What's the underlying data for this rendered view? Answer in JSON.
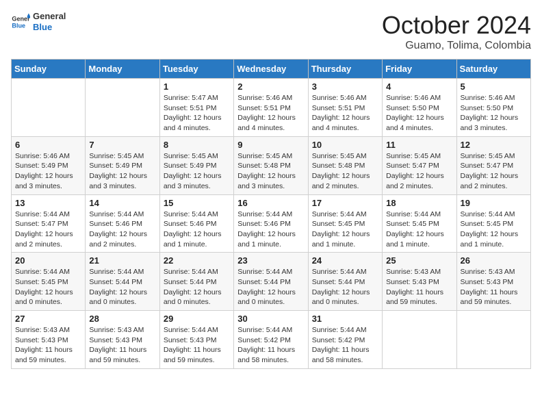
{
  "header": {
    "logo_line1": "General",
    "logo_line2": "Blue",
    "month": "October 2024",
    "location": "Guamo, Tolima, Colombia"
  },
  "weekdays": [
    "Sunday",
    "Monday",
    "Tuesday",
    "Wednesday",
    "Thursday",
    "Friday",
    "Saturday"
  ],
  "weeks": [
    [
      {
        "day": "",
        "sunrise": "",
        "sunset": "",
        "daylight": ""
      },
      {
        "day": "",
        "sunrise": "",
        "sunset": "",
        "daylight": ""
      },
      {
        "day": "1",
        "sunrise": "Sunrise: 5:47 AM",
        "sunset": "Sunset: 5:51 PM",
        "daylight": "Daylight: 12 hours and 4 minutes."
      },
      {
        "day": "2",
        "sunrise": "Sunrise: 5:46 AM",
        "sunset": "Sunset: 5:51 PM",
        "daylight": "Daylight: 12 hours and 4 minutes."
      },
      {
        "day": "3",
        "sunrise": "Sunrise: 5:46 AM",
        "sunset": "Sunset: 5:51 PM",
        "daylight": "Daylight: 12 hours and 4 minutes."
      },
      {
        "day": "4",
        "sunrise": "Sunrise: 5:46 AM",
        "sunset": "Sunset: 5:50 PM",
        "daylight": "Daylight: 12 hours and 4 minutes."
      },
      {
        "day": "5",
        "sunrise": "Sunrise: 5:46 AM",
        "sunset": "Sunset: 5:50 PM",
        "daylight": "Daylight: 12 hours and 3 minutes."
      }
    ],
    [
      {
        "day": "6",
        "sunrise": "Sunrise: 5:46 AM",
        "sunset": "Sunset: 5:49 PM",
        "daylight": "Daylight: 12 hours and 3 minutes."
      },
      {
        "day": "7",
        "sunrise": "Sunrise: 5:45 AM",
        "sunset": "Sunset: 5:49 PM",
        "daylight": "Daylight: 12 hours and 3 minutes."
      },
      {
        "day": "8",
        "sunrise": "Sunrise: 5:45 AM",
        "sunset": "Sunset: 5:49 PM",
        "daylight": "Daylight: 12 hours and 3 minutes."
      },
      {
        "day": "9",
        "sunrise": "Sunrise: 5:45 AM",
        "sunset": "Sunset: 5:48 PM",
        "daylight": "Daylight: 12 hours and 3 minutes."
      },
      {
        "day": "10",
        "sunrise": "Sunrise: 5:45 AM",
        "sunset": "Sunset: 5:48 PM",
        "daylight": "Daylight: 12 hours and 2 minutes."
      },
      {
        "day": "11",
        "sunrise": "Sunrise: 5:45 AM",
        "sunset": "Sunset: 5:47 PM",
        "daylight": "Daylight: 12 hours and 2 minutes."
      },
      {
        "day": "12",
        "sunrise": "Sunrise: 5:45 AM",
        "sunset": "Sunset: 5:47 PM",
        "daylight": "Daylight: 12 hours and 2 minutes."
      }
    ],
    [
      {
        "day": "13",
        "sunrise": "Sunrise: 5:44 AM",
        "sunset": "Sunset: 5:47 PM",
        "daylight": "Daylight: 12 hours and 2 minutes."
      },
      {
        "day": "14",
        "sunrise": "Sunrise: 5:44 AM",
        "sunset": "Sunset: 5:46 PM",
        "daylight": "Daylight: 12 hours and 2 minutes."
      },
      {
        "day": "15",
        "sunrise": "Sunrise: 5:44 AM",
        "sunset": "Sunset: 5:46 PM",
        "daylight": "Daylight: 12 hours and 1 minute."
      },
      {
        "day": "16",
        "sunrise": "Sunrise: 5:44 AM",
        "sunset": "Sunset: 5:46 PM",
        "daylight": "Daylight: 12 hours and 1 minute."
      },
      {
        "day": "17",
        "sunrise": "Sunrise: 5:44 AM",
        "sunset": "Sunset: 5:45 PM",
        "daylight": "Daylight: 12 hours and 1 minute."
      },
      {
        "day": "18",
        "sunrise": "Sunrise: 5:44 AM",
        "sunset": "Sunset: 5:45 PM",
        "daylight": "Daylight: 12 hours and 1 minute."
      },
      {
        "day": "19",
        "sunrise": "Sunrise: 5:44 AM",
        "sunset": "Sunset: 5:45 PM",
        "daylight": "Daylight: 12 hours and 1 minute."
      }
    ],
    [
      {
        "day": "20",
        "sunrise": "Sunrise: 5:44 AM",
        "sunset": "Sunset: 5:45 PM",
        "daylight": "Daylight: 12 hours and 0 minutes."
      },
      {
        "day": "21",
        "sunrise": "Sunrise: 5:44 AM",
        "sunset": "Sunset: 5:44 PM",
        "daylight": "Daylight: 12 hours and 0 minutes."
      },
      {
        "day": "22",
        "sunrise": "Sunrise: 5:44 AM",
        "sunset": "Sunset: 5:44 PM",
        "daylight": "Daylight: 12 hours and 0 minutes."
      },
      {
        "day": "23",
        "sunrise": "Sunrise: 5:44 AM",
        "sunset": "Sunset: 5:44 PM",
        "daylight": "Daylight: 12 hours and 0 minutes."
      },
      {
        "day": "24",
        "sunrise": "Sunrise: 5:44 AM",
        "sunset": "Sunset: 5:44 PM",
        "daylight": "Daylight: 12 hours and 0 minutes."
      },
      {
        "day": "25",
        "sunrise": "Sunrise: 5:43 AM",
        "sunset": "Sunset: 5:43 PM",
        "daylight": "Daylight: 11 hours and 59 minutes."
      },
      {
        "day": "26",
        "sunrise": "Sunrise: 5:43 AM",
        "sunset": "Sunset: 5:43 PM",
        "daylight": "Daylight: 11 hours and 59 minutes."
      }
    ],
    [
      {
        "day": "27",
        "sunrise": "Sunrise: 5:43 AM",
        "sunset": "Sunset: 5:43 PM",
        "daylight": "Daylight: 11 hours and 59 minutes."
      },
      {
        "day": "28",
        "sunrise": "Sunrise: 5:43 AM",
        "sunset": "Sunset: 5:43 PM",
        "daylight": "Daylight: 11 hours and 59 minutes."
      },
      {
        "day": "29",
        "sunrise": "Sunrise: 5:44 AM",
        "sunset": "Sunset: 5:43 PM",
        "daylight": "Daylight: 11 hours and 59 minutes."
      },
      {
        "day": "30",
        "sunrise": "Sunrise: 5:44 AM",
        "sunset": "Sunset: 5:42 PM",
        "daylight": "Daylight: 11 hours and 58 minutes."
      },
      {
        "day": "31",
        "sunrise": "Sunrise: 5:44 AM",
        "sunset": "Sunset: 5:42 PM",
        "daylight": "Daylight: 11 hours and 58 minutes."
      },
      {
        "day": "",
        "sunrise": "",
        "sunset": "",
        "daylight": ""
      },
      {
        "day": "",
        "sunrise": "",
        "sunset": "",
        "daylight": ""
      }
    ]
  ]
}
